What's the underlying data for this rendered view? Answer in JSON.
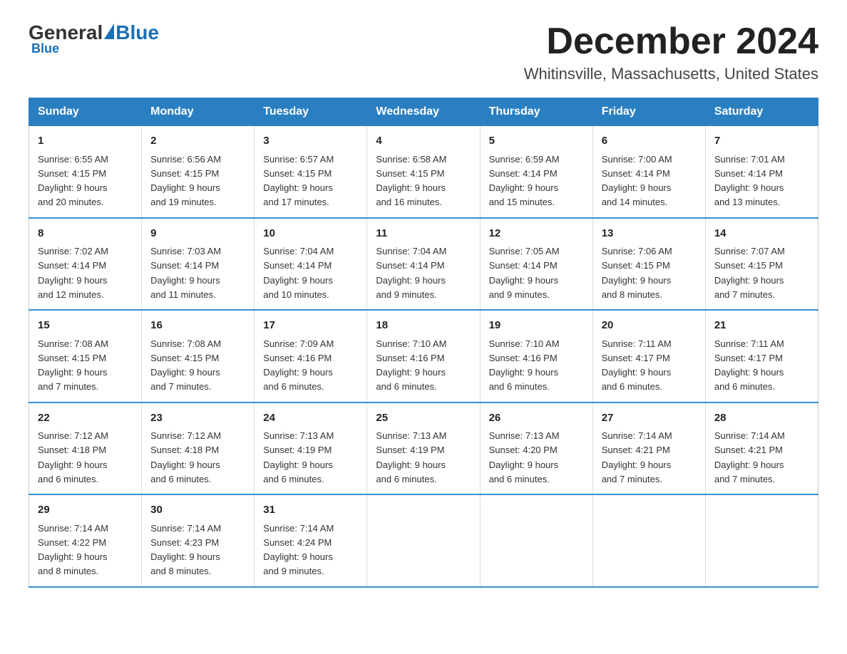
{
  "logo": {
    "general": "General",
    "blue": "Blue"
  },
  "header": {
    "month": "December 2024",
    "location": "Whitinsville, Massachusetts, United States"
  },
  "weekdays": [
    "Sunday",
    "Monday",
    "Tuesday",
    "Wednesday",
    "Thursday",
    "Friday",
    "Saturday"
  ],
  "weeks": [
    [
      {
        "day": "1",
        "sunrise": "6:55 AM",
        "sunset": "4:15 PM",
        "daylight": "9 hours and 20 minutes."
      },
      {
        "day": "2",
        "sunrise": "6:56 AM",
        "sunset": "4:15 PM",
        "daylight": "9 hours and 19 minutes."
      },
      {
        "day": "3",
        "sunrise": "6:57 AM",
        "sunset": "4:15 PM",
        "daylight": "9 hours and 17 minutes."
      },
      {
        "day": "4",
        "sunrise": "6:58 AM",
        "sunset": "4:15 PM",
        "daylight": "9 hours and 16 minutes."
      },
      {
        "day": "5",
        "sunrise": "6:59 AM",
        "sunset": "4:14 PM",
        "daylight": "9 hours and 15 minutes."
      },
      {
        "day": "6",
        "sunrise": "7:00 AM",
        "sunset": "4:14 PM",
        "daylight": "9 hours and 14 minutes."
      },
      {
        "day": "7",
        "sunrise": "7:01 AM",
        "sunset": "4:14 PM",
        "daylight": "9 hours and 13 minutes."
      }
    ],
    [
      {
        "day": "8",
        "sunrise": "7:02 AM",
        "sunset": "4:14 PM",
        "daylight": "9 hours and 12 minutes."
      },
      {
        "day": "9",
        "sunrise": "7:03 AM",
        "sunset": "4:14 PM",
        "daylight": "9 hours and 11 minutes."
      },
      {
        "day": "10",
        "sunrise": "7:04 AM",
        "sunset": "4:14 PM",
        "daylight": "9 hours and 10 minutes."
      },
      {
        "day": "11",
        "sunrise": "7:04 AM",
        "sunset": "4:14 PM",
        "daylight": "9 hours and 9 minutes."
      },
      {
        "day": "12",
        "sunrise": "7:05 AM",
        "sunset": "4:14 PM",
        "daylight": "9 hours and 9 minutes."
      },
      {
        "day": "13",
        "sunrise": "7:06 AM",
        "sunset": "4:15 PM",
        "daylight": "9 hours and 8 minutes."
      },
      {
        "day": "14",
        "sunrise": "7:07 AM",
        "sunset": "4:15 PM",
        "daylight": "9 hours and 7 minutes."
      }
    ],
    [
      {
        "day": "15",
        "sunrise": "7:08 AM",
        "sunset": "4:15 PM",
        "daylight": "9 hours and 7 minutes."
      },
      {
        "day": "16",
        "sunrise": "7:08 AM",
        "sunset": "4:15 PM",
        "daylight": "9 hours and 7 minutes."
      },
      {
        "day": "17",
        "sunrise": "7:09 AM",
        "sunset": "4:16 PM",
        "daylight": "9 hours and 6 minutes."
      },
      {
        "day": "18",
        "sunrise": "7:10 AM",
        "sunset": "4:16 PM",
        "daylight": "9 hours and 6 minutes."
      },
      {
        "day": "19",
        "sunrise": "7:10 AM",
        "sunset": "4:16 PM",
        "daylight": "9 hours and 6 minutes."
      },
      {
        "day": "20",
        "sunrise": "7:11 AM",
        "sunset": "4:17 PM",
        "daylight": "9 hours and 6 minutes."
      },
      {
        "day": "21",
        "sunrise": "7:11 AM",
        "sunset": "4:17 PM",
        "daylight": "9 hours and 6 minutes."
      }
    ],
    [
      {
        "day": "22",
        "sunrise": "7:12 AM",
        "sunset": "4:18 PM",
        "daylight": "9 hours and 6 minutes."
      },
      {
        "day": "23",
        "sunrise": "7:12 AM",
        "sunset": "4:18 PM",
        "daylight": "9 hours and 6 minutes."
      },
      {
        "day": "24",
        "sunrise": "7:13 AM",
        "sunset": "4:19 PM",
        "daylight": "9 hours and 6 minutes."
      },
      {
        "day": "25",
        "sunrise": "7:13 AM",
        "sunset": "4:19 PM",
        "daylight": "9 hours and 6 minutes."
      },
      {
        "day": "26",
        "sunrise": "7:13 AM",
        "sunset": "4:20 PM",
        "daylight": "9 hours and 6 minutes."
      },
      {
        "day": "27",
        "sunrise": "7:14 AM",
        "sunset": "4:21 PM",
        "daylight": "9 hours and 7 minutes."
      },
      {
        "day": "28",
        "sunrise": "7:14 AM",
        "sunset": "4:21 PM",
        "daylight": "9 hours and 7 minutes."
      }
    ],
    [
      {
        "day": "29",
        "sunrise": "7:14 AM",
        "sunset": "4:22 PM",
        "daylight": "9 hours and 8 minutes."
      },
      {
        "day": "30",
        "sunrise": "7:14 AM",
        "sunset": "4:23 PM",
        "daylight": "9 hours and 8 minutes."
      },
      {
        "day": "31",
        "sunrise": "7:14 AM",
        "sunset": "4:24 PM",
        "daylight": "9 hours and 9 minutes."
      },
      null,
      null,
      null,
      null
    ]
  ]
}
